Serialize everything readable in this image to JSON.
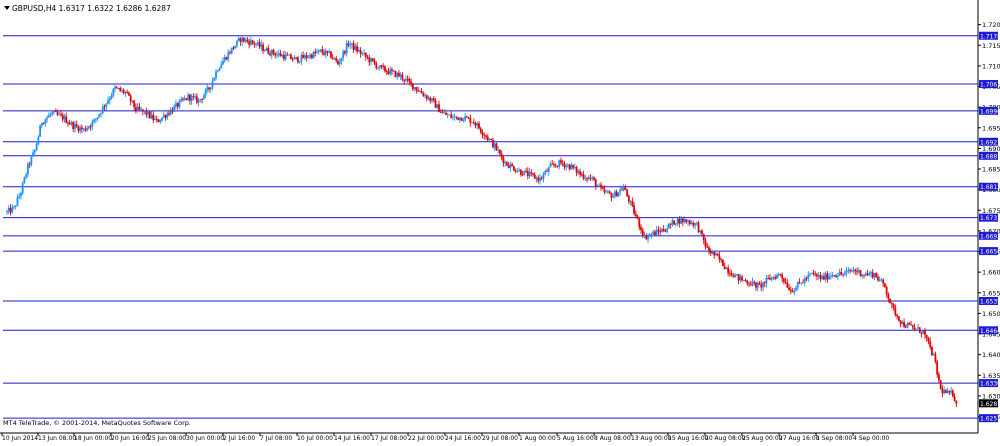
{
  "header": {
    "symbol_info": "GBPUSD,H4 1.6317 1.6322 1.6286 1.6287"
  },
  "footer": {
    "copyright": "MT4 TeleTrade, © 2001-2014, MetaQuotes Software Corp."
  },
  "colors": {
    "background": "#ffffff",
    "bull_candle": "#1e90ff",
    "bear_candle": "#e00000",
    "level_line": "#1c1cd8",
    "level_label_bg": "#1c1cd8",
    "level_label_text": "#ffffff",
    "price_label_bg": "#000000",
    "axis": "#000000",
    "text": "#000000"
  },
  "chart_data": {
    "type": "candlestick",
    "title": "GBPUSD,H4",
    "ohlc_readout": {
      "open": 1.6317,
      "high": 1.6322,
      "low": 1.6286,
      "close": 1.6287
    },
    "ylim": [
      1.6215,
      1.7255
    ],
    "y_ticks": [
      "1.7205",
      "1.7155",
      "1.7105",
      "1.7055",
      "1.7005",
      "1.6955",
      "1.6905",
      "1.6855",
      "1.6805",
      "1.6755",
      "1.6705",
      "1.6655",
      "1.6605",
      "1.6555",
      "1.6505",
      "1.6455",
      "1.6405",
      "1.6355",
      "1.6305",
      "1.6255"
    ],
    "x_tick_labels": [
      "10 Jun 2014",
      "13 Jun 08:00",
      "18 Jun 00:00",
      "20 Jun 16:00",
      "25 Jun 08:00",
      "30 Jun 00:00",
      "2 Jul 16:00",
      "7 Jul 08:00",
      "10 Jul 00:00",
      "14 Jul 16:00",
      "17 Jul 08:00",
      "22 Jul 00:00",
      "24 Jul 16:00",
      "29 Jul 08:00",
      "1 Aug 00:00",
      "5 Aug 16:00",
      "8 Aug 08:00",
      "13 Aug 00:00",
      "15 Aug 16:00",
      "20 Aug 08:00",
      "25 Aug 00:00",
      "27 Aug 16:00",
      "1 Sep 08:00",
      "4 Sep 00:00"
    ],
    "horizontal_levels": [
      "1.7178",
      "1.7061",
      "1.6996",
      "1.6921",
      "1.6887",
      "1.6812",
      "1.6737",
      "1.6693",
      "1.6656",
      "1.6535",
      "1.6464",
      "1.6336",
      "1.6251"
    ],
    "current_price": "1.6287",
    "close_path": [
      [
        0,
        1.675
      ],
      [
        4,
        1.676
      ],
      [
        8,
        1.68
      ],
      [
        12,
        1.686
      ],
      [
        16,
        1.69
      ],
      [
        20,
        1.697
      ],
      [
        26,
        1.699
      ],
      [
        32,
        1.698
      ],
      [
        38,
        1.696
      ],
      [
        44,
        1.695
      ],
      [
        50,
        1.697
      ],
      [
        56,
        1.701
      ],
      [
        62,
        1.705
      ],
      [
        68,
        1.704
      ],
      [
        74,
        1.7
      ],
      [
        80,
        1.699
      ],
      [
        86,
        1.697
      ],
      [
        92,
        1.699
      ],
      [
        98,
        1.701
      ],
      [
        104,
        1.703
      ],
      [
        110,
        1.702
      ],
      [
        116,
        1.705
      ],
      [
        121,
        1.71
      ],
      [
        128,
        1.714
      ],
      [
        134,
        1.717
      ],
      [
        142,
        1.716
      ],
      [
        150,
        1.714
      ],
      [
        158,
        1.713
      ],
      [
        166,
        1.712
      ],
      [
        174,
        1.713
      ],
      [
        180,
        1.714
      ],
      [
        186,
        1.713
      ],
      [
        190,
        1.711
      ],
      [
        196,
        1.716
      ],
      [
        202,
        1.714
      ],
      [
        208,
        1.712
      ],
      [
        214,
        1.71
      ],
      [
        220,
        1.709
      ],
      [
        226,
        1.708
      ],
      [
        232,
        1.706
      ],
      [
        238,
        1.704
      ],
      [
        244,
        1.702
      ],
      [
        250,
        1.699
      ],
      [
        256,
        1.698
      ],
      [
        262,
        1.698
      ],
      [
        268,
        1.697
      ],
      [
        274,
        1.694
      ],
      [
        280,
        1.691
      ],
      [
        286,
        1.687
      ],
      [
        290,
        1.686
      ],
      [
        294,
        1.685
      ],
      [
        300,
        1.684
      ],
      [
        306,
        1.683
      ],
      [
        312,
        1.686
      ],
      [
        318,
        1.687
      ],
      [
        324,
        1.686
      ],
      [
        330,
        1.684
      ],
      [
        336,
        1.683
      ],
      [
        342,
        1.68
      ],
      [
        348,
        1.679
      ],
      [
        354,
        1.681
      ],
      [
        360,
        1.675
      ],
      [
        366,
        1.669
      ],
      [
        372,
        1.67
      ],
      [
        378,
        1.671
      ],
      [
        384,
        1.673
      ],
      [
        390,
        1.673
      ],
      [
        396,
        1.672
      ],
      [
        402,
        1.666
      ],
      [
        408,
        1.664
      ],
      [
        414,
        1.661
      ],
      [
        420,
        1.659
      ],
      [
        426,
        1.658
      ],
      [
        432,
        1.657
      ],
      [
        438,
        1.659
      ],
      [
        444,
        1.66
      ],
      [
        450,
        1.656
      ],
      [
        456,
        1.658
      ],
      [
        462,
        1.66
      ],
      [
        468,
        1.659
      ],
      [
        474,
        1.66
      ],
      [
        480,
        1.66
      ],
      [
        486,
        1.661
      ],
      [
        492,
        1.66
      ],
      [
        498,
        1.66
      ],
      [
        504,
        1.657
      ],
      [
        508,
        1.652
      ],
      [
        514,
        1.648
      ],
      [
        520,
        1.647
      ],
      [
        526,
        1.646
      ],
      [
        532,
        1.64
      ],
      [
        536,
        1.632
      ],
      [
        540,
        1.631
      ],
      [
        543,
        1.631
      ],
      [
        545,
        1.629
      ]
    ],
    "candle_count": 546
  }
}
